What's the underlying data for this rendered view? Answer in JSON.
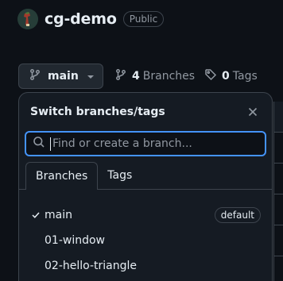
{
  "repo": {
    "name": "cg-demo",
    "visibility": "Public"
  },
  "branch_bar": {
    "current_branch": "main",
    "branches_count": "4",
    "branches_label": "Branches",
    "tags_count": "0",
    "tags_label": "Tags"
  },
  "dropdown": {
    "title": "Switch branches/tags",
    "search_placeholder": "Find or create a branch...",
    "tabs": [
      {
        "label": "Branches",
        "active": true
      },
      {
        "label": "Tags",
        "active": false
      }
    ],
    "branches": [
      {
        "name": "main",
        "selected": true,
        "badge": "default"
      },
      {
        "name": "01-window",
        "selected": false,
        "badge": ""
      },
      {
        "name": "02-hello-triangle",
        "selected": false,
        "badge": ""
      }
    ]
  },
  "colors": {
    "background": "#0d1117",
    "panel": "#151b23",
    "border": "#3d444d",
    "focus_ring": "#4493f8",
    "text": "#e6edf3",
    "muted_text": "#9198a1"
  },
  "icons": {
    "branch": "git-branch-icon",
    "tag": "tag-icon",
    "search": "search-icon",
    "close": "close-icon",
    "check": "check-icon",
    "dropdown": "triangle-down-icon"
  }
}
